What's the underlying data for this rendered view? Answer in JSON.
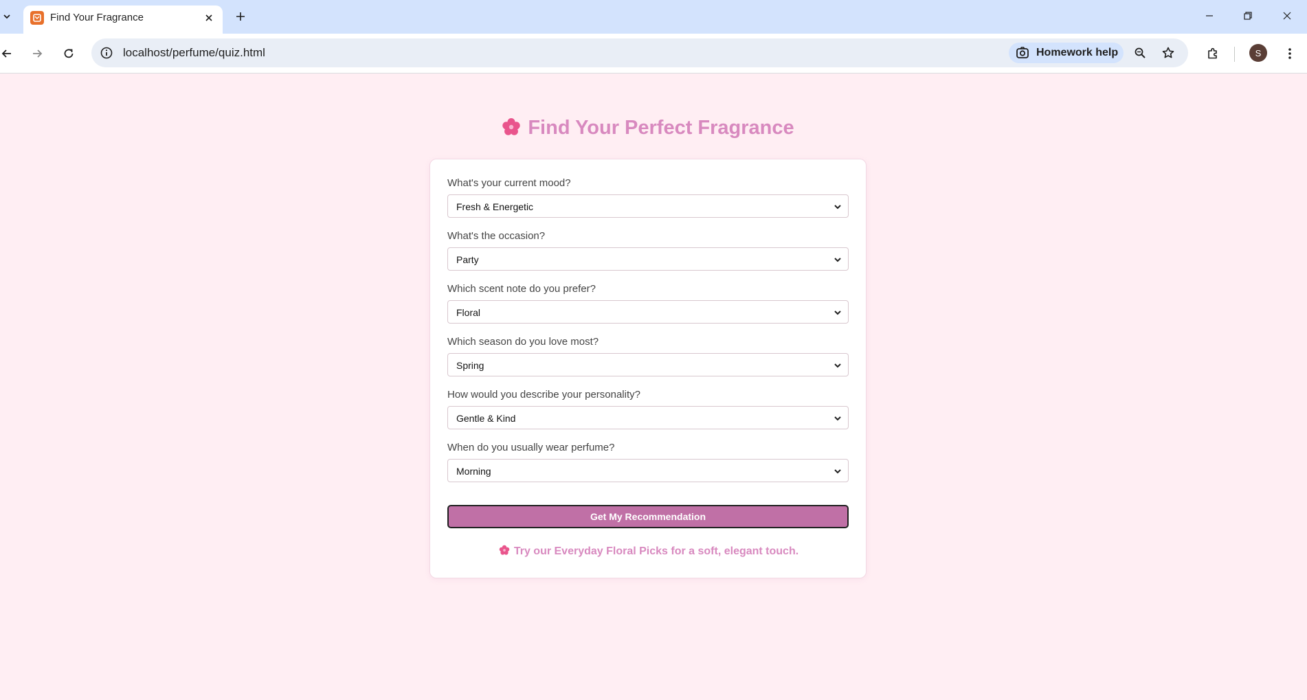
{
  "browser": {
    "tab_title": "Find Your Fragrance",
    "url": "localhost/perfume/quiz.html",
    "homework_chip_label": "Homework help",
    "profile_initial": "S"
  },
  "page": {
    "title": "Find Your Perfect Fragrance",
    "questions": [
      {
        "label": "What's your current mood?",
        "selected": "Fresh & Energetic"
      },
      {
        "label": "What's the occasion?",
        "selected": "Party"
      },
      {
        "label": "Which scent note do you prefer?",
        "selected": "Floral"
      },
      {
        "label": "Which season do you love most?",
        "selected": "Spring"
      },
      {
        "label": "How would you describe your personality?",
        "selected": "Gentle & Kind"
      },
      {
        "label": "When do you usually wear perfume?",
        "selected": "Morning"
      }
    ],
    "submit_label": "Get My Recommendation",
    "result_text": "Try our Everyday Floral Picks for a soft, elegant touch."
  },
  "colors": {
    "page_background": "#ffeef3",
    "accent_pink": "#d889bf",
    "button_fill": "#c070a6",
    "flower_icon": "#e9558c"
  },
  "icons": {
    "title_icon": "cherry-blossom-icon",
    "result_icon": "cherry-blossom-icon"
  }
}
